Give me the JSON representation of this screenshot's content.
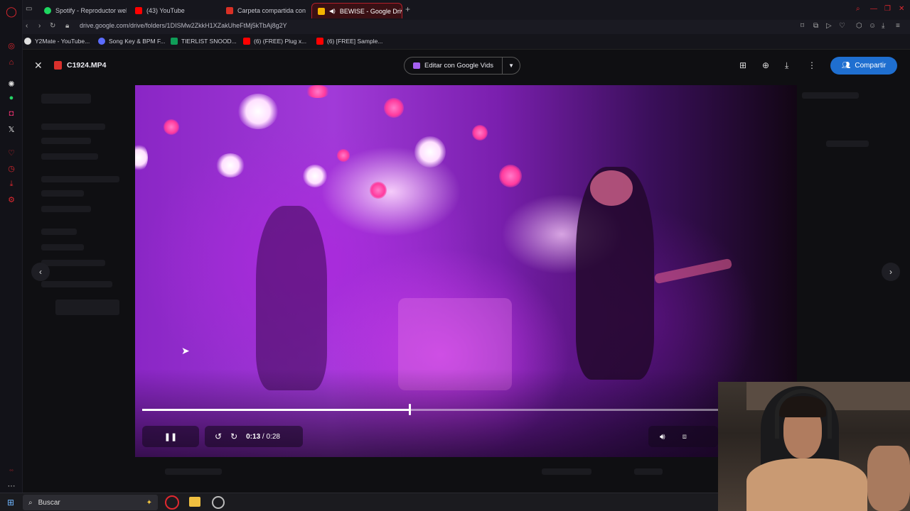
{
  "browser": {
    "tabs": [
      {
        "label": "Spotify - Reproductor web",
        "favicon_color": "#1ed760"
      },
      {
        "label": "(43) YouTube",
        "favicon_color": "#ff0000"
      },
      {
        "label": "Carpeta compartida con",
        "favicon_color": "#d93025"
      },
      {
        "label": "BEWISE - Google Drive",
        "favicon_color": "#f4b400"
      }
    ],
    "url": "drive.google.com/drive/folders/1DISMw2ZkkH1XZakUheFtMj5kTbAj8g2Y",
    "bookmarks": [
      {
        "label": "Y2Mate - YouTube...",
        "icon_color": "#e0e0e0"
      },
      {
        "label": "Song Key & BPM F...",
        "icon_color": "#5b6cff"
      },
      {
        "label": "TIERLIST SNOOD...",
        "icon_color": "#0f9d58"
      },
      {
        "label": "(6) (FREE) Plug x...",
        "icon_color": "#ff0000"
      },
      {
        "label": "(6) [FREE] Sample...",
        "icon_color": "#ff0000"
      }
    ]
  },
  "viewer": {
    "file_name": "C1924.MP4",
    "edit_button_label": "Editar con Google Vids",
    "share_button_label": "Compartir"
  },
  "player": {
    "current_time": "0:13",
    "duration": "/ 0:28",
    "progress_fraction": 0.464
  },
  "taskbar": {
    "search_placeholder": "Buscar"
  },
  "colors": {
    "accent_blue": "#1f6fd0",
    "video_purple": "#9a2ed0",
    "opera_red": "#d9202c"
  }
}
